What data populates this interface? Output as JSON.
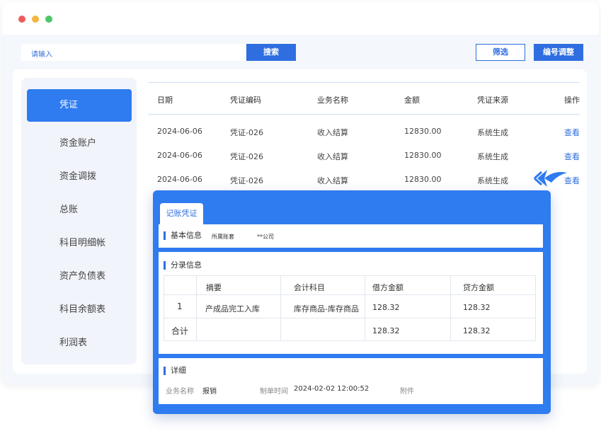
{
  "toolbar": {
    "search_placeholder": "请输入",
    "search_button": "搜索",
    "filter_button": "筛选",
    "renumber_button": "编号调整"
  },
  "sidebar": {
    "items": [
      {
        "label": "凭证",
        "active": true
      },
      {
        "label": "资金账户"
      },
      {
        "label": "资金调拨"
      },
      {
        "label": "总账"
      },
      {
        "label": "科目明细帐"
      },
      {
        "label": "资产负债表"
      },
      {
        "label": "科目余额表"
      },
      {
        "label": "利润表"
      }
    ]
  },
  "table": {
    "headers": [
      "日期",
      "凭证编码",
      "业务名称",
      "金额",
      "凭证来源",
      "操作"
    ],
    "rows": [
      [
        "2024-06-06",
        "凭证-026",
        "收入结算",
        "12830.00",
        "系统生成",
        "查看"
      ],
      [
        "2024-06-06",
        "凭证-026",
        "收入结算",
        "12830.00",
        "系统生成",
        "查看"
      ],
      [
        "2024-06-06",
        "凭证-026",
        "收入结算",
        "12830.00",
        "系统生成",
        "查看"
      ]
    ]
  },
  "panel": {
    "tab_label": "记账凭证",
    "basic": {
      "title": "基本信息",
      "account_set_label": "所属账套",
      "account_set_value": "**公司"
    },
    "entries": {
      "title": "分录信息",
      "headers": [
        "",
        "摘要",
        "会计科目",
        "借方金额",
        "贷方金额"
      ],
      "rows": [
        [
          "1",
          "产成品完工入库",
          "库存商品-库存商品",
          "128.32",
          "128.32"
        ],
        [
          "合计",
          "",
          "",
          "128.32",
          "128.32"
        ]
      ]
    },
    "detail": {
      "title": "详细",
      "business_label": "业务名称",
      "business_value": "报销",
      "created_label": "制单时间",
      "created_value": "2024-02-02 12:00:52",
      "attachment_label": "附件"
    }
  },
  "colors": {
    "accent": "#2f7bf0",
    "link": "#2f6ee0"
  },
  "icons": [
    "arrow-pointer-icon"
  ]
}
